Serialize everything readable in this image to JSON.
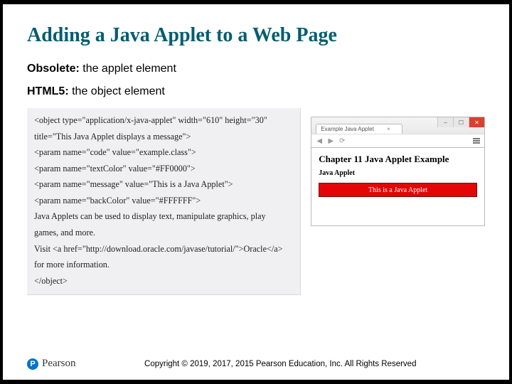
{
  "title": "Adding a Java Applet to a Web Page",
  "bullets": {
    "obsolete_label": "Obsolete:",
    "obsolete_text": " the applet element",
    "html5_label": "HTML5:",
    "html5_text": " the object element"
  },
  "code": {
    "l1": "<object type=\"application/x-java-applet\" width=\"610\" height=\"30\"",
    "l2": "title=\"This Java Applet displays a message\">",
    "l3": "<param name=\"code\" value=\"example.class\">",
    "l4": "<param name=\"textColor\" value=\"#FF0000\">",
    "l5": "<param name=\"message\" value=\"This is a Java Applet\">",
    "l6": "<param name=\"backColor\" value=\"#FFFFFF\">",
    "l7": "Java Applets can be used to display text, manipulate graphics, play",
    "l8": "games, and more.",
    "l9": "Visit <a href=\"http://download.oracle.com/javase/tutorial/\">Oracle</a>",
    "l10": "for more information.",
    "l11": "</object>"
  },
  "browser": {
    "tab_title": "Example Java Applet",
    "page_heading": "Chapter 11 Java Applet Example",
    "page_sub": "Java Applet",
    "applet_text": "This is a Java Applet"
  },
  "footer": {
    "logo_text": "Pearson",
    "copyright": "Copyright © 2019, 2017, 2015 Pearson Education, Inc. All Rights Reserved"
  }
}
